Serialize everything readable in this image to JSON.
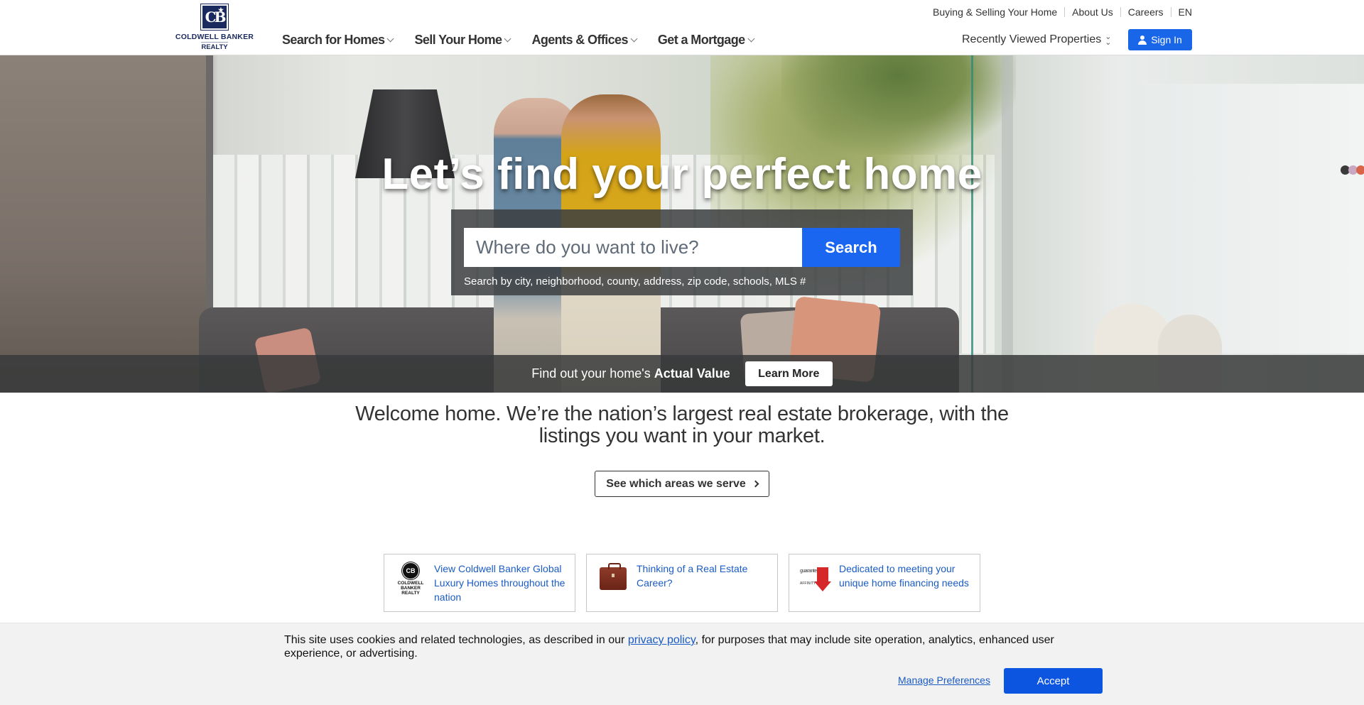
{
  "header": {
    "logo": {
      "name": "COLDWELL BANKER",
      "sub": "REALTY",
      "mark": "CB",
      "alt": "coldwell-banker-realty-logo"
    },
    "main_nav": [
      {
        "label": "Search for Homes"
      },
      {
        "label": "Sell Your Home"
      },
      {
        "label": "Agents & Offices"
      },
      {
        "label": "Get a Mortgage"
      }
    ],
    "util_nav": [
      {
        "label": "Buying & Selling Your Home"
      },
      {
        "label": "About Us"
      },
      {
        "label": "Careers"
      },
      {
        "label": "EN"
      }
    ],
    "recently_viewed": "Recently Viewed Properties",
    "sign_in": "Sign In"
  },
  "hero": {
    "title": "Let’s find your perfect home",
    "search": {
      "placeholder": "Where do you want to live?",
      "value": "",
      "button": "Search",
      "hint": "Search by city, neighborhood, county, address, zip code, schools, MLS #"
    },
    "value_bar": {
      "text_prefix": "Find out your home's ",
      "text_bold": "Actual Value",
      "button": "Learn More"
    }
  },
  "welcome": {
    "line1": "Welcome home. We’re the nation’s largest real estate brokerage, with the",
    "line2": "listings you want in your market.",
    "areas_button": "See which areas we serve"
  },
  "promo_cards": [
    {
      "icon": "global-luxury-logo",
      "logo_text": "COLDWELL BANKER REALTY",
      "text": "View Coldwell Banker Global Luxury Homes throughout the nation"
    },
    {
      "icon": "briefcase-icon",
      "text": "Thinking of a Real Estate Career?"
    },
    {
      "icon": "guaranteed-rate-logo",
      "logo_text": "guaranteed Rate AFFINITY",
      "text": "Dedicated to meeting your unique home financing needs"
    }
  ],
  "cookie_banner": {
    "text_before": "This site uses cookies and related technologies, as described in our ",
    "link": "privacy policy",
    "text_after": ", for purposes that may include site operation, analytics, enhanced user experience, or advertising.",
    "manage": "Manage Preferences",
    "accept": "Accept"
  },
  "colors": {
    "brand_navy": "#1b2a5e",
    "primary_blue": "#1a66e8",
    "accept_blue": "#0b55e0",
    "link_blue": "#1a5bc4"
  }
}
